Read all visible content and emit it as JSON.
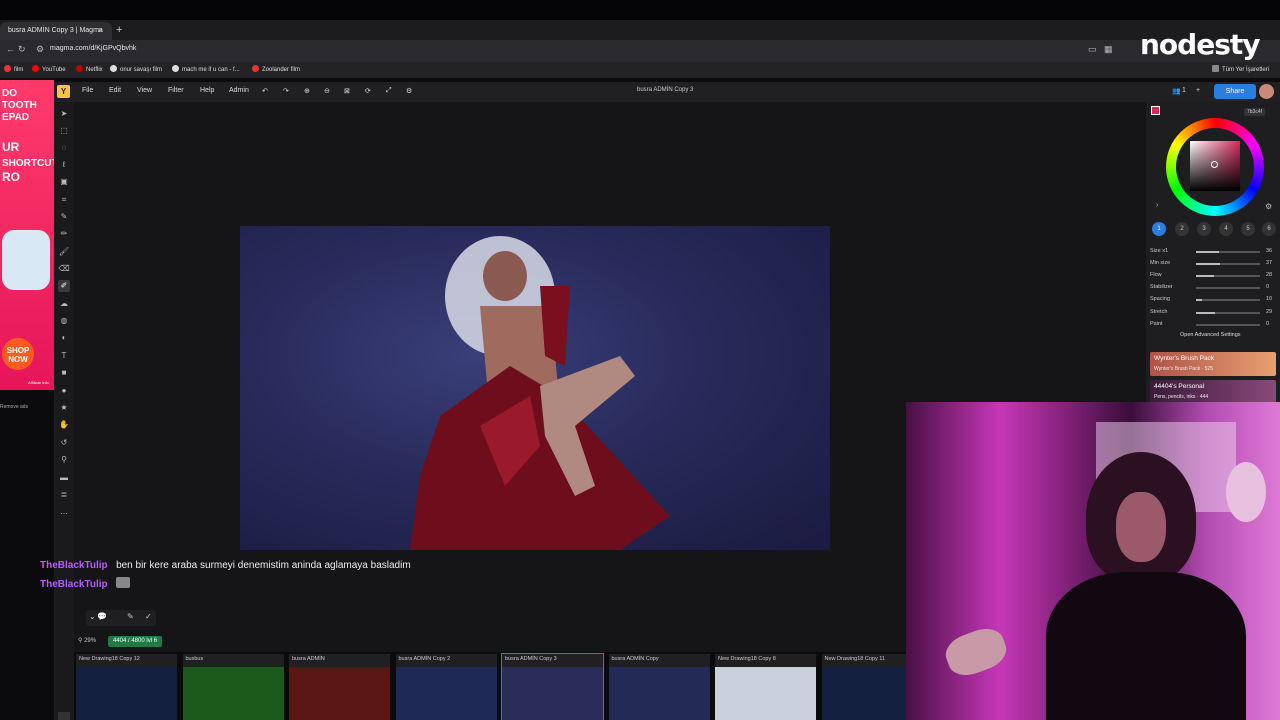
{
  "browser": {
    "tab_title": "busra ADMİN Copy 3 | Magma",
    "tab_close": "×",
    "new_tab": "+",
    "url": "magma.com/d/KjGPvQbvhk",
    "bookmarks": [
      "film",
      "YouTube",
      "Netflix",
      "onur savaşı film",
      "mach me if u can - f...",
      "Zoolander film"
    ],
    "all_bookmarks": "Tüm Yer İşaretleri"
  },
  "brand_overlay": "nodesty",
  "app": {
    "menu": [
      "File",
      "Edit",
      "View",
      "Filter",
      "Help",
      "Admin"
    ],
    "document_title": "busra ADMİN Copy 3",
    "users_count": "1",
    "share_label": "Share"
  },
  "ad": {
    "lines": [
      "DO",
      "TOOTH",
      "EPAD",
      "UR",
      "SHORTCUTS",
      "RO"
    ],
    "shop": "SHOP NOW",
    "note": "Affiliate Info",
    "remove": "Remove ads"
  },
  "color": {
    "hex": "7b3c4f",
    "accent": "#d8285e"
  },
  "brush_presets": [
    "1",
    "2",
    "3",
    "4",
    "5",
    "6"
  ],
  "brush_props": [
    {
      "label": "Size x1",
      "value": "36",
      "fill": 0.36
    },
    {
      "label": "Min size",
      "value": "37",
      "fill": 0.37
    },
    {
      "label": "Flow",
      "value": "28",
      "fill": 0.28
    },
    {
      "label": "Stabilizer",
      "value": "0",
      "fill": 0.0
    },
    {
      "label": "Spacing",
      "value": "10",
      "fill": 0.1
    },
    {
      "label": "Stretch",
      "value": "29",
      "fill": 0.29
    },
    {
      "label": "Paint",
      "value": "0",
      "fill": 0.0
    }
  ],
  "advanced_settings": "Open Advanced Settings",
  "brush_packs": [
    {
      "title": "Wynter's Brush Pack",
      "sub": "Wynter's Brush Pack · 525"
    },
    {
      "title": "44404's Personal",
      "sub": "Pens, pencils, inks · 444"
    }
  ],
  "chat": [
    {
      "user": "TheBlackTulip",
      "message": "ben bir kere araba surmeyi denemistim aninda aglamaya basladim"
    },
    {
      "user": "TheBlackTulip",
      "message": ""
    }
  ],
  "status": {
    "zoom": "29%",
    "xp": "4404 / 4800  lvl 6"
  },
  "thumbnails": [
    {
      "label": "New Drawing18 Copy 12",
      "color": "#132040"
    },
    {
      "label": "busbus",
      "color": "#1c5a1c"
    },
    {
      "label": "busra ADMİN",
      "color": "#5a1515"
    },
    {
      "label": "busra ADMİN Copy 2",
      "color": "#1e2a55"
    },
    {
      "label": "busra ADMİN Copy 3",
      "color": "#2a2c5a"
    },
    {
      "label": "busra ADMİN Copy",
      "color": "#222a55"
    },
    {
      "label": "New Drawing18 Copy 8",
      "color": "#c9d2dc"
    },
    {
      "label": "New Drawing18 Copy 11",
      "color": "#132040"
    }
  ]
}
